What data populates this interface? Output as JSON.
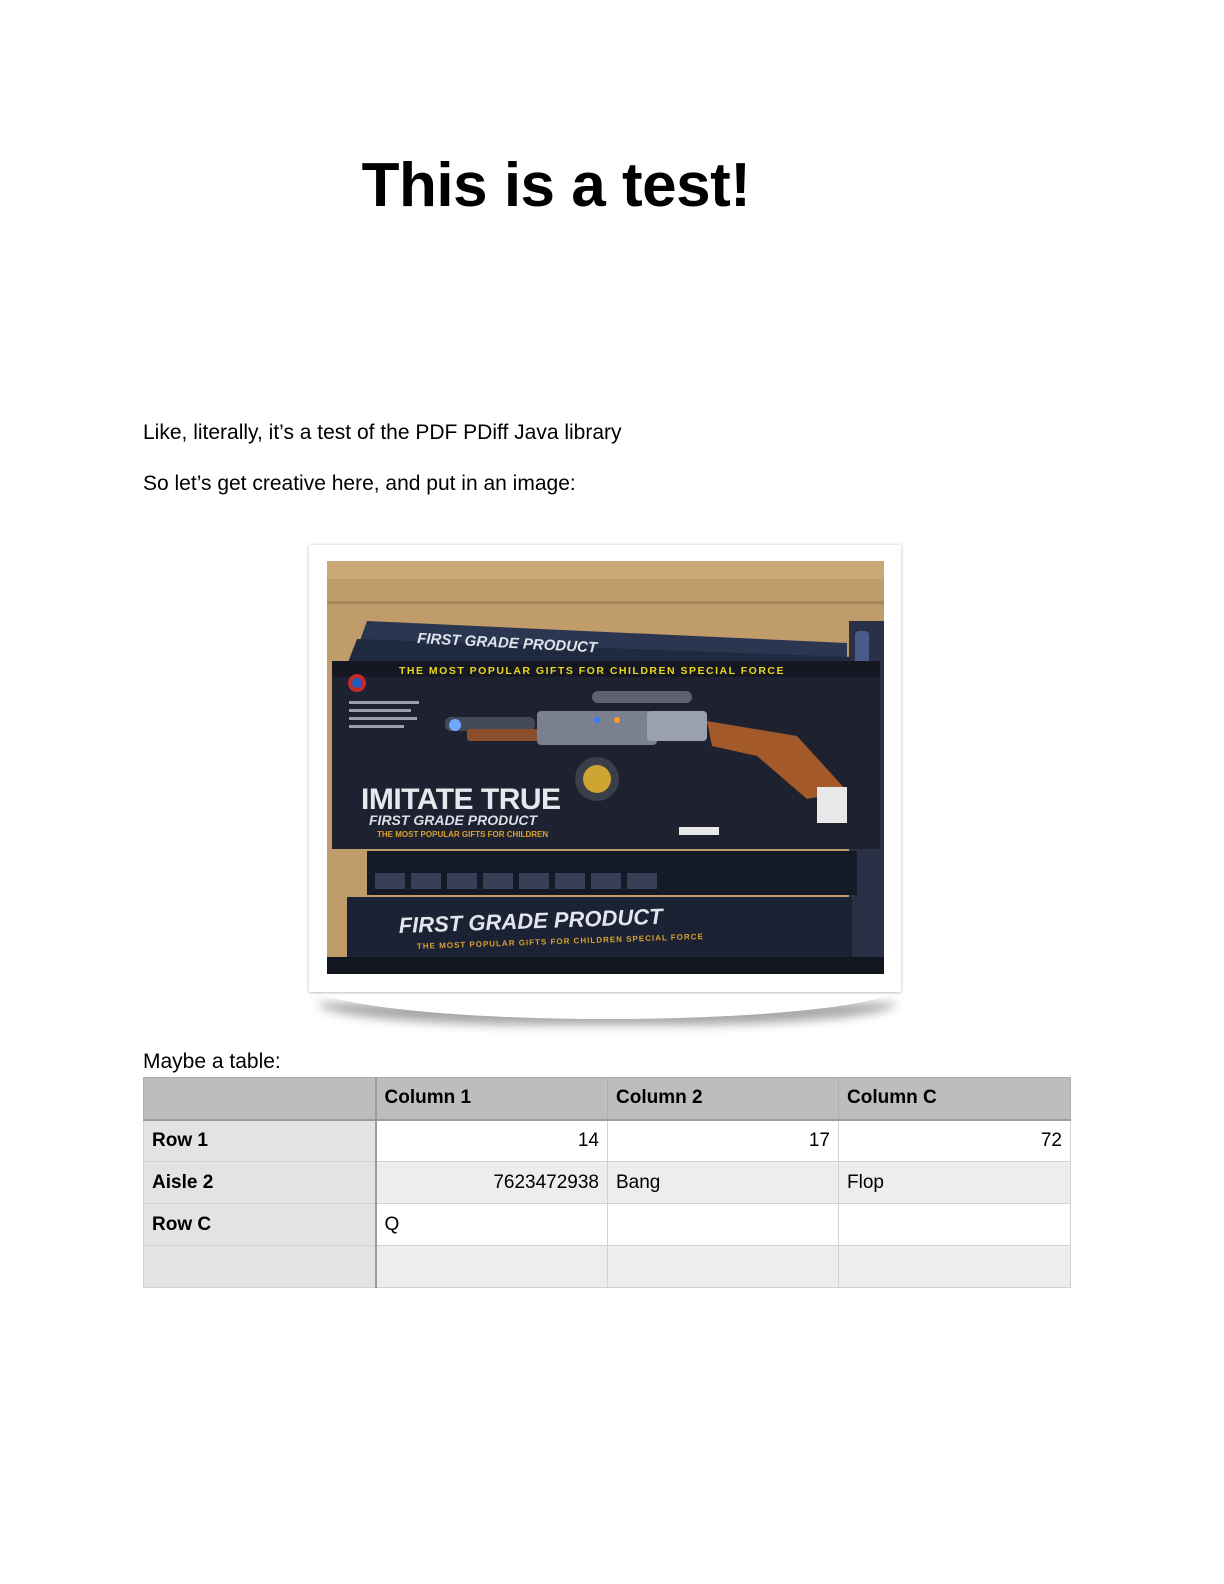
{
  "document": {
    "title": "This is a test!",
    "paragraphs": [
      "Like, literally, it’s a test of the PDF PDiff Java library",
      "So let’s get creative here, and put in an image:",
      "Maybe a table:"
    ]
  },
  "image": {
    "box_text_top": "FIRST GRADE PRODUCT",
    "box_tagline": "THE MOST POPULAR GIFTS FOR CHILDREN SPECIAL FORCE",
    "box_brand": "IMITATE TRUE",
    "box_subbrand": "FIRST GRADE PRODUCT",
    "box_small": "THE MOST POPULAR GIFTS FOR CHILDREN",
    "box_bottom": "FIRST GRADE PRODUCT",
    "box_bottom_tagline": "THE MOST POPULAR GIFTS FOR CHILDREN SPECIAL FORCE"
  },
  "table": {
    "headers": [
      "",
      "Column 1",
      "Column 2",
      "Column C"
    ],
    "rows": [
      {
        "label": "Row 1",
        "cells": [
          "14",
          "17",
          "72"
        ]
      },
      {
        "label": "Aisle 2",
        "cells": [
          "7623472938",
          "Bang",
          "Flop"
        ]
      },
      {
        "label": "Row C",
        "cells": [
          "Q",
          "",
          ""
        ]
      },
      {
        "label": "",
        "cells": [
          "",
          "",
          ""
        ]
      }
    ]
  }
}
